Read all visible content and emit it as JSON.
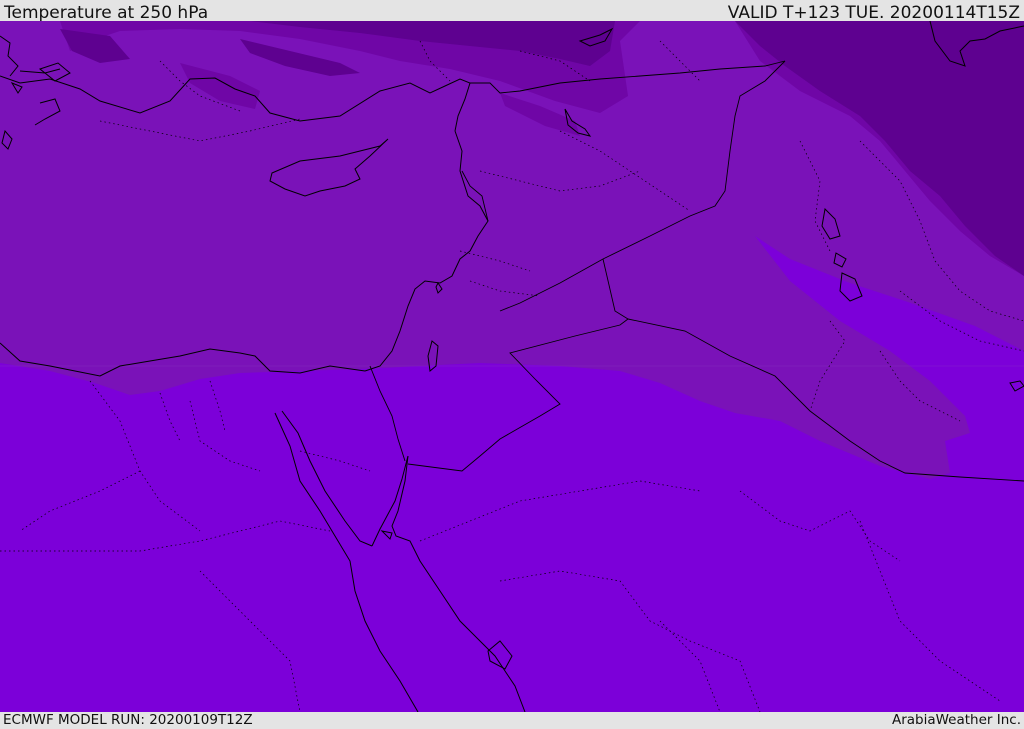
{
  "header": {
    "title": "Temperature at 250 hPa",
    "valid_time": "VALID T+123 TUE. 20200114T15Z"
  },
  "footer": {
    "model_run": "ECMWF MODEL RUN: 20200109T12Z",
    "credit": "ArabiaWeather Inc."
  },
  "map": {
    "region": "Eastern Mediterranean and Middle East",
    "field": "temperature-250hPa",
    "colors": {
      "base": "#7c00d9",
      "band_mid": "#7a12b8",
      "band_cold": "#6f06a6",
      "band_coldest": "#5e0190",
      "borders": "#000000"
    }
  }
}
